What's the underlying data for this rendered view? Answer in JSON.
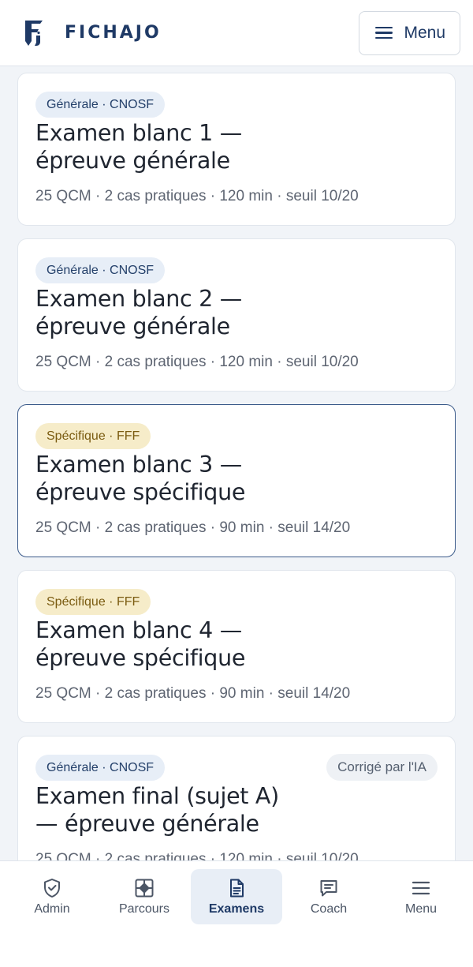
{
  "header": {
    "brand": "FICHAJO",
    "menu_label": "Menu"
  },
  "exams": [
    {
      "tag": "Générale · CNOSF",
      "tag_type": "general",
      "title_line1": "Examen blanc 1 —",
      "title_line2": "épreuve générale",
      "meta": "25 QCM · 2 cas pratiques · 120 min · seuil 10/20",
      "badge": ""
    },
    {
      "tag": "Générale · CNOSF",
      "tag_type": "general",
      "title_line1": "Examen blanc 2 —",
      "title_line2": "épreuve générale",
      "meta": "25 QCM · 2 cas pratiques · 120 min · seuil 10/20",
      "badge": ""
    },
    {
      "tag": "Spécifique · FFF",
      "tag_type": "specific",
      "title_line1": "Examen blanc 3 —",
      "title_line2": "épreuve spécifique",
      "meta": "25 QCM · 2 cas pratiques · 90 min · seuil 14/20",
      "badge": ""
    },
    {
      "tag": "Spécifique · FFF",
      "tag_type": "specific",
      "title_line1": "Examen blanc 4 —",
      "title_line2": "épreuve spécifique",
      "meta": "25 QCM · 2 cas pratiques · 90 min · seuil 14/20",
      "badge": ""
    },
    {
      "tag": "Générale · CNOSF",
      "tag_type": "general",
      "title_line1": "Examen final (sujet A)",
      "title_line2": "— épreuve générale",
      "meta": "25 QCM · 2 cas pratiques · 120 min · seuil 10/20",
      "badge": "Corrigé par l'IA"
    }
  ],
  "nav": {
    "items": [
      {
        "label": "Admin",
        "icon": "shield-check-icon"
      },
      {
        "label": "Parcours",
        "icon": "compass-icon"
      },
      {
        "label": "Examens",
        "icon": "document-icon"
      },
      {
        "label": "Coach",
        "icon": "chat-icon"
      },
      {
        "label": "Menu",
        "icon": "menu-icon"
      }
    ],
    "active": "Examens"
  },
  "colors": {
    "brand": "#1f3a66",
    "general_tag_bg": "#e7eef7",
    "specific_tag_bg": "#f6ecc9",
    "active_border": "#3b5a8a"
  }
}
